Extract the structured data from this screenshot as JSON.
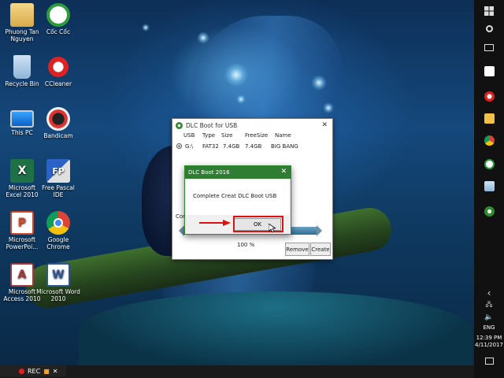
{
  "desktop_icons": [
    {
      "label": "Phuong Tan Nguyen",
      "icon": "user-folder-icon"
    },
    {
      "label": "Cốc Cốc",
      "icon": "coccoc-browser-icon"
    },
    {
      "label": "Recycle Bin",
      "icon": "recycle-bin-icon"
    },
    {
      "label": "CCleaner",
      "icon": "ccleaner-icon"
    },
    {
      "label": "This PC",
      "icon": "this-pc-icon"
    },
    {
      "label": "Bandicam",
      "icon": "bandicam-icon"
    },
    {
      "label": "Microsoft Excel 2010",
      "icon": "excel-icon"
    },
    {
      "label": "Free Pascal IDE",
      "icon": "free-pascal-icon"
    },
    {
      "label": "Microsoft PowerPoi...",
      "icon": "powerpoint-icon"
    },
    {
      "label": "Google Chrome",
      "icon": "chrome-icon"
    },
    {
      "label": "Microsoft Access 2010",
      "icon": "access-icon"
    },
    {
      "label": "Microsoft Word 2010",
      "icon": "word-icon"
    }
  ],
  "dlc_window": {
    "title": "DLC Boot for USB",
    "close": "✕",
    "columns": {
      "usb": "USB",
      "type": "Type",
      "size": "Size",
      "freesize": "FreeSize",
      "name": "Name"
    },
    "drive": {
      "letter": "G:\\",
      "type": "FAT32",
      "size": "7.4GB",
      "freesize": "7.4GB",
      "name": "BIG BANG"
    },
    "status_label": "Comp",
    "progress_value": 1.0,
    "progress_text": "100 %",
    "remove_button": "Remove",
    "create_button": "Create"
  },
  "message_box": {
    "title": "DLC Boot 2016",
    "close": "✕",
    "text": "Complete Creat DLC Boot USB",
    "ok_button": "OK"
  },
  "taskbar": {
    "language": "ENG",
    "time": "12:39 PM",
    "date": "4/11/2017"
  },
  "recorder": {
    "label": "REC",
    "close": "✕"
  },
  "colors": {
    "accent_green": "#2e7d32",
    "highlight_red": "#e01010",
    "taskbar": "#111111"
  }
}
